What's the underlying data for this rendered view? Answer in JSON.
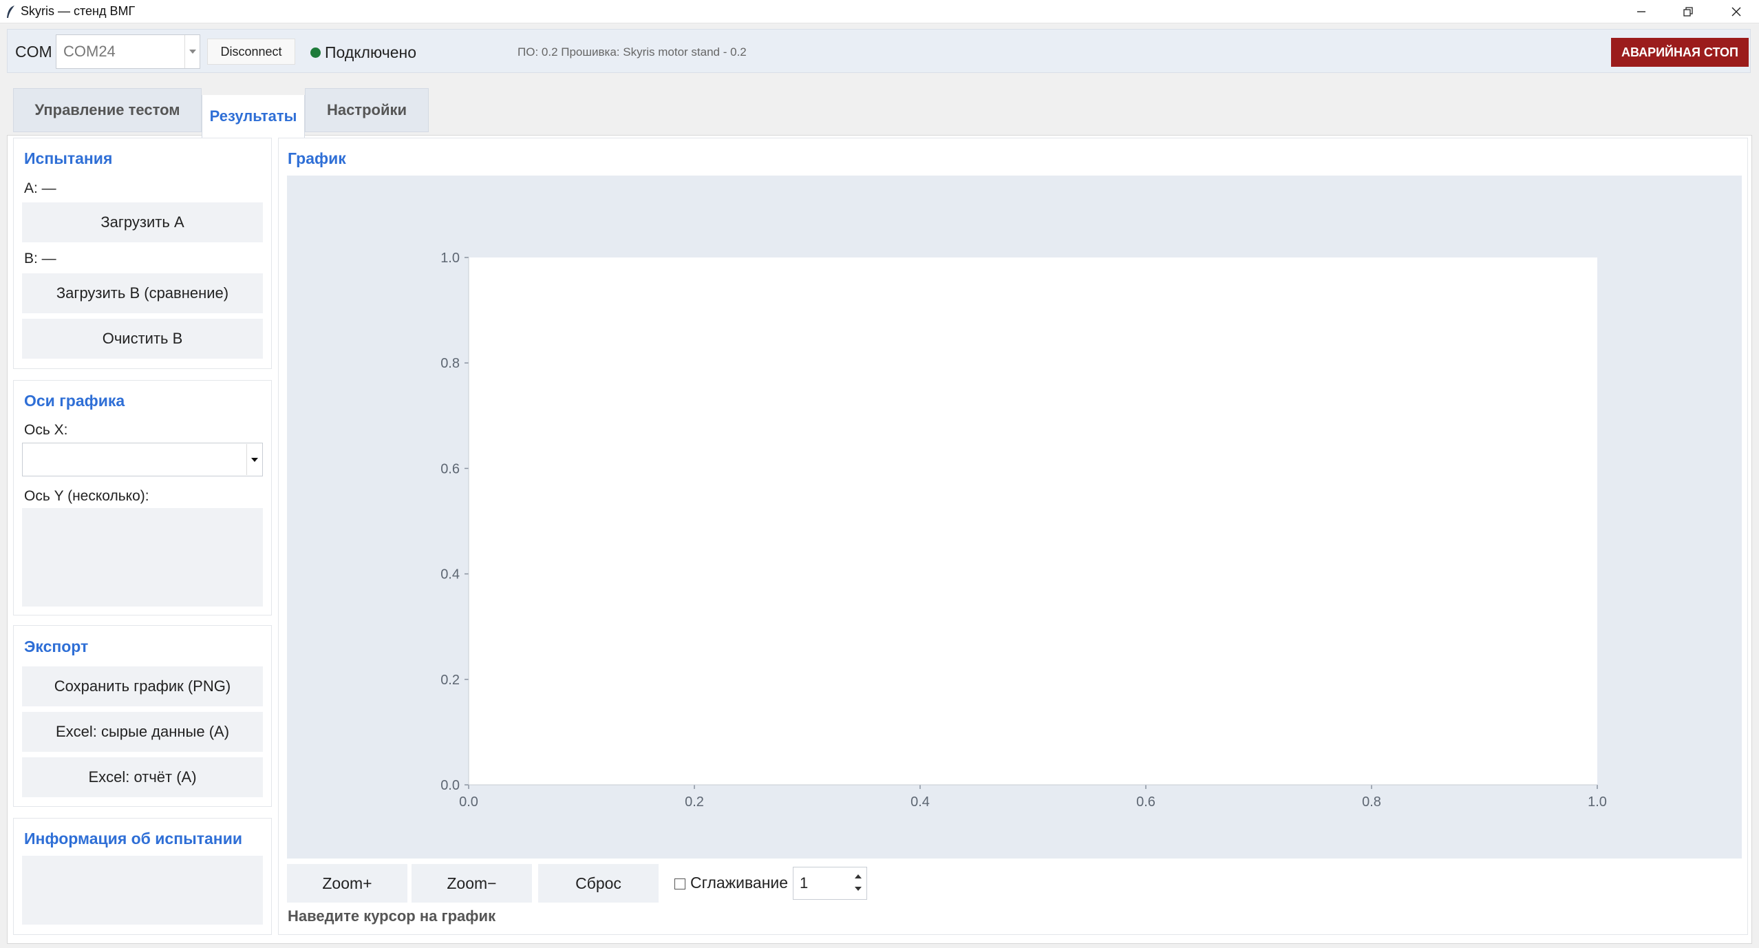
{
  "window": {
    "title": "Skyris — стенд ВМГ",
    "icons": [
      "feather-icon",
      "minimize-icon",
      "restore-icon",
      "close-icon"
    ]
  },
  "topbar": {
    "com_label": "COM",
    "com_value": "COM24",
    "disconnect_label": "Disconnect",
    "status_text": "Подключено",
    "status_color": "#1e7b3a",
    "firmware_text": "ПО: 0.2   Прошивка: Skyris motor stand - 0.2",
    "estop_label": "АВАРИЙНАЯ СТОП",
    "estop_color": "#9b1c1c"
  },
  "tabs": [
    {
      "label": "Управление тестом",
      "active": false
    },
    {
      "label": "Результаты",
      "active": true
    },
    {
      "label": "Настройки",
      "active": false
    }
  ],
  "tests_panel": {
    "title": "Испытания",
    "a_label": "A: —",
    "load_a": "Загрузить A",
    "b_label": "B: —",
    "load_b": "Загрузить B (сравнение)",
    "clear_b": "Очистить B"
  },
  "axes_panel": {
    "title": "Оси графика",
    "x_label": "Ось X:",
    "x_value": "",
    "y_label": "Ось Y (несколько):"
  },
  "export_panel": {
    "title": "Экспорт",
    "save_png": "Сохранить график (PNG)",
    "excel_raw": "Excel: сырые данные (A)",
    "excel_report": "Excel: отчёт (A)"
  },
  "info_panel": {
    "title": "Информация об испытании"
  },
  "graph": {
    "title": "График",
    "zoom_in": "Zoom+",
    "zoom_out": "Zoom−",
    "reset": "Сброс",
    "smoothing_label": "Сглаживание",
    "smoothing_checked": false,
    "smoothing_value": "1",
    "hover_hint": "Наведите курсор на график"
  },
  "chart_data": {
    "type": "line",
    "series": [],
    "xlim": [
      0.0,
      1.0
    ],
    "ylim": [
      0.0,
      1.0
    ],
    "x_ticks": [
      "0.0",
      "0.2",
      "0.4",
      "0.6",
      "0.8",
      "1.0"
    ],
    "y_ticks": [
      "0.0",
      "0.2",
      "0.4",
      "0.6",
      "0.8",
      "1.0"
    ],
    "grid": false,
    "plot_bg": "#e6ebf2"
  },
  "colors": {
    "accent": "#2f6fd6"
  }
}
